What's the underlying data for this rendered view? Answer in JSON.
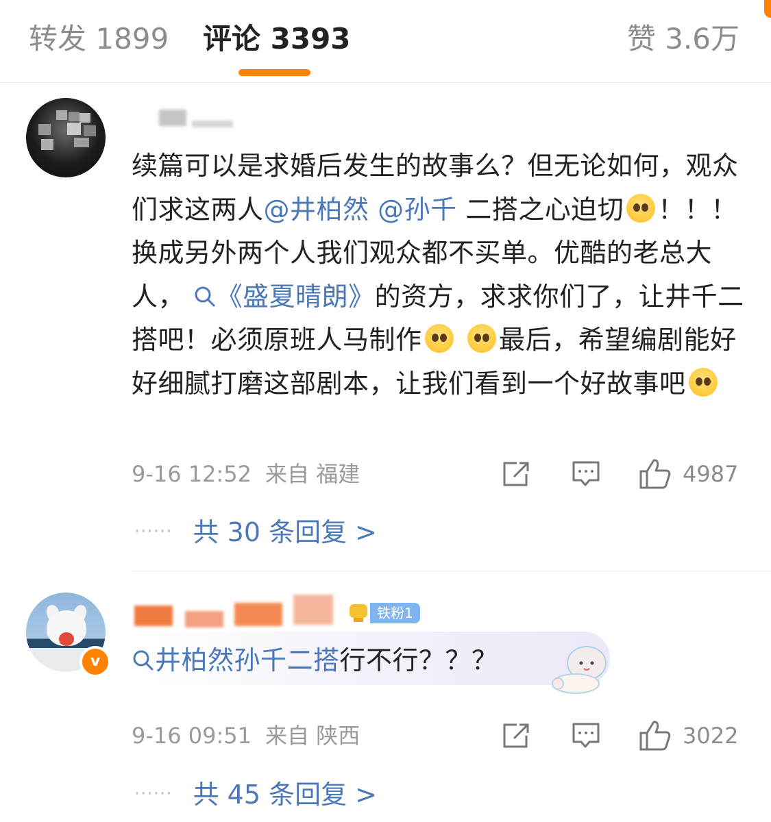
{
  "tabs": {
    "forward": "转发 1899",
    "comments": "评论 3393",
    "likes": "赞 3.6万"
  },
  "colors": {
    "accent": "#ff8200",
    "link": "#4a78b8",
    "fan_badge": "#7fb4ee"
  },
  "comments": [
    {
      "text_parts": {
        "a": "续篇可以是求婚后发生的故事么？但无论如何，观众们求这两人",
        "mention1": "@井柏然",
        "mention2": "@孙千",
        "b": " 二搭之心迫切",
        "c": "！！！ 换成另外两个人我们观众都不买单。优酷的老总大人，",
        "topic": "《盛夏晴朗》",
        "d": "的资方，求求你们了，让井千二搭吧！必须原班人马制作",
        "e": "最后，希望编剧能好好细腻打磨这部剧本，让我们看到一个好故事吧"
      },
      "time": "9-16 12:52",
      "location": "来自 福建",
      "likes": "4987",
      "replies": "共 30 条回复 >"
    },
    {
      "fan_badge": "铁粉1",
      "verified_mark": "v",
      "text_parts": {
        "topic": "井柏然孙千二搭",
        "rest": "行不行？？？"
      },
      "time": "9-16 09:51",
      "location": "来自 陕西",
      "likes": "3022",
      "replies": "共 45 条回复 >"
    }
  ],
  "icons": [
    "share-icon",
    "comment-icon",
    "like-icon",
    "search-icon",
    "emoji-icon",
    "cup-icon"
  ]
}
